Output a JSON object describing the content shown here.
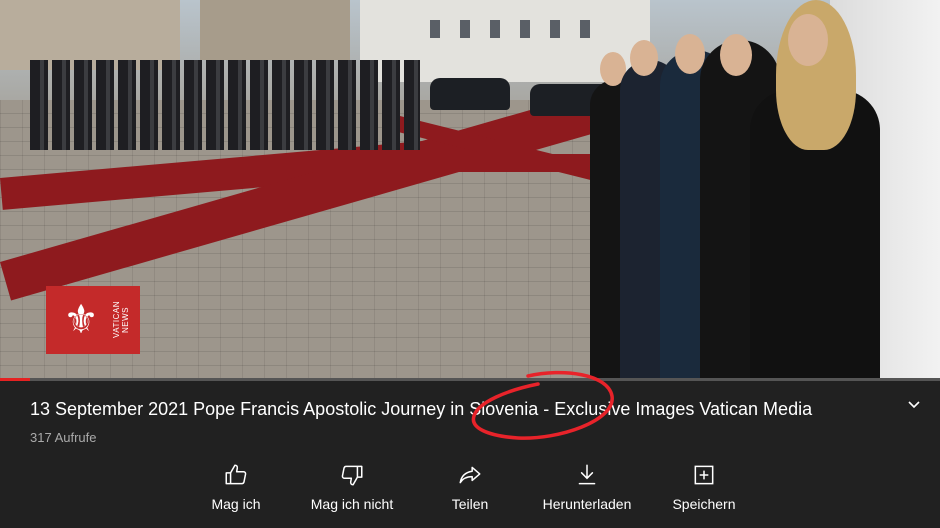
{
  "video": {
    "watermark": "VATICAN NEWS",
    "progress": 0.032
  },
  "title": "13 September 2021 Pope Francis Apostolic Journey in Slovenia - Exclusive Images Vatican Media",
  "views": "317 Aufrufe",
  "actions": [
    {
      "label": "Mag ich",
      "icon": "thumbs-up-icon"
    },
    {
      "label": "Mag ich nicht",
      "icon": "thumbs-down-icon"
    },
    {
      "label": "Teilen",
      "icon": "share-icon"
    },
    {
      "label": "Herunterladen",
      "icon": "download-icon"
    },
    {
      "label": "Speichern",
      "icon": "save-to-playlist-icon"
    }
  ],
  "colors": {
    "background": "#212121",
    "progress": "#e52222",
    "annotation": "#e8232a",
    "logo": "#c42a2a"
  }
}
